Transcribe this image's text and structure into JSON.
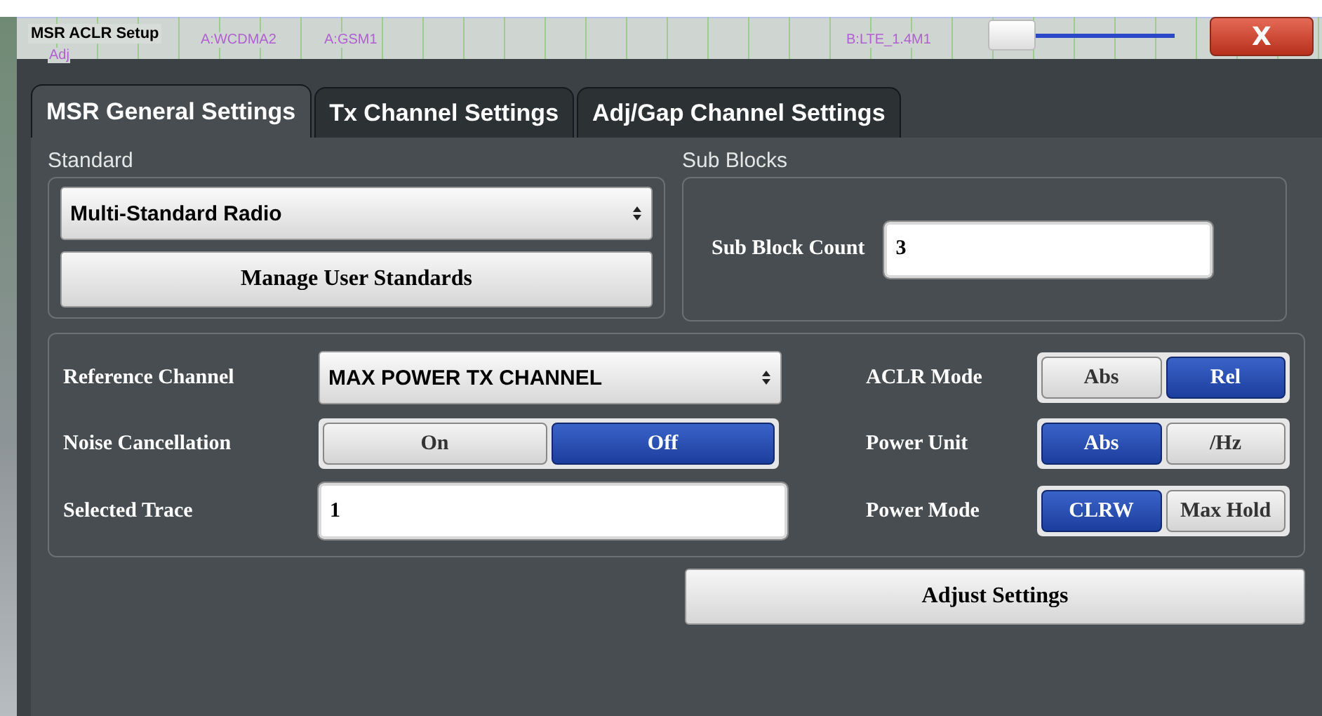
{
  "window": {
    "title": "MSR ACLR Setup",
    "close_label": "X"
  },
  "background_labels": [
    "Adj",
    "A:WCDMA2",
    "A:GSM1",
    "B:LTE_1.4M1"
  ],
  "transparency_slider": {
    "level": 0.2
  },
  "tabs": [
    {
      "label": "MSR General Settings",
      "selected": true
    },
    {
      "label": "Tx Channel Settings",
      "selected": false
    },
    {
      "label": "Adj/Gap Channel Settings",
      "selected": false
    }
  ],
  "standard": {
    "title": "Standard",
    "dropdown_value": "Multi-Standard Radio",
    "button": "Manage User Standards"
  },
  "sub_blocks": {
    "title": "Sub Blocks",
    "field_label": "Sub Block Count",
    "value": "3"
  },
  "left_settings": [
    {
      "kind": "dropdown",
      "label": "Reference Channel",
      "value": "MAX POWER TX CHANNEL"
    },
    {
      "kind": "toggle",
      "label": "Noise Cancellation",
      "options": [
        {
          "label": "On",
          "selected": false
        },
        {
          "label": "Off",
          "selected": true
        }
      ]
    },
    {
      "kind": "input",
      "label": "Selected Trace",
      "value": "1"
    }
  ],
  "right_settings": [
    {
      "kind": "toggle",
      "label": "ACLR Mode",
      "options": [
        {
          "label": "Abs",
          "selected": false
        },
        {
          "label": "Rel",
          "selected": true
        }
      ]
    },
    {
      "kind": "toggle",
      "label": "Power Unit",
      "options": [
        {
          "label": "Abs",
          "selected": true
        },
        {
          "label": "/Hz",
          "selected": false
        }
      ]
    },
    {
      "kind": "toggle",
      "label": "Power Mode",
      "options": [
        {
          "label": "CLRW",
          "selected": true
        },
        {
          "label": "Max Hold",
          "selected": false
        }
      ]
    }
  ],
  "adjust_button": "Adjust Settings"
}
